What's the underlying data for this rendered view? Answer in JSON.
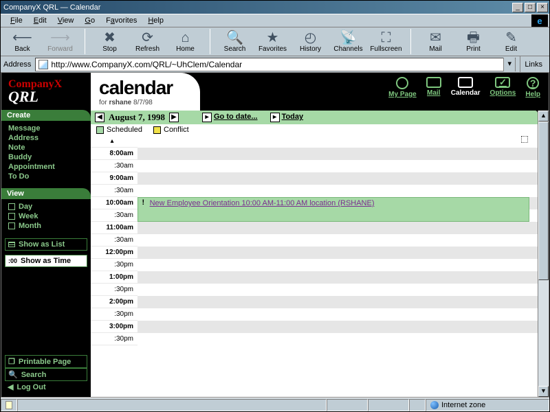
{
  "window": {
    "title": "CompanyX QRL — Calendar"
  },
  "menubar": {
    "file": "File",
    "edit": "Edit",
    "view": "View",
    "go": "Go",
    "favorites": "Favorites",
    "help": "Help"
  },
  "toolbar": {
    "back": "Back",
    "forward": "Forward",
    "stop": "Stop",
    "refresh": "Refresh",
    "home": "Home",
    "search": "Search",
    "favorites": "Favorites",
    "history": "History",
    "channels": "Channels",
    "fullscreen": "Fullscreen",
    "mail": "Mail",
    "print": "Print",
    "edit": "Edit"
  },
  "address": {
    "label": "Address",
    "url": "http://www.CompanyX.com/QRL/~UhClem/Calendar",
    "links": "Links"
  },
  "brand": {
    "company": "CompanyX",
    "app": "QRL"
  },
  "sidebar": {
    "create_head": "Create",
    "create": [
      "Message",
      "Address",
      "Note",
      "Buddy",
      "Appointment",
      "To Do"
    ],
    "view_head": "View",
    "view": [
      "Day",
      "Week",
      "Month"
    ],
    "show_list": "Show as List",
    "show_time": "Show as Time",
    "printable": "Printable Page",
    "search": "Search",
    "logout": "Log Out"
  },
  "header": {
    "title": "calendar",
    "for_prefix": "for ",
    "user": "rshane",
    "date_short": "8/7/98"
  },
  "topnav": {
    "mypage": "My Page",
    "mail": "Mail",
    "calendar": "Calendar",
    "options": "Options",
    "help": "Help"
  },
  "datebar": {
    "date": "August 7, 1998",
    "goto": "Go to date...",
    "today": "Today"
  },
  "legend": {
    "scheduled": "Scheduled",
    "conflict": "Conflict"
  },
  "times": [
    "8:00am",
    ":30am",
    "9:00am",
    ":30am",
    "10:00am",
    ":30am",
    "11:00am",
    ":30am",
    "12:00pm",
    ":30pm",
    "1:00pm",
    ":30pm",
    "2:00pm",
    ":30pm",
    "3:00pm",
    ":30pm"
  ],
  "event": {
    "text": "New Employee Orientation 10:00 AM-11:00 AM location (RSHANE)"
  },
  "status": {
    "zone": "Internet zone"
  },
  "colors": {
    "scheduled": "#a6d9a6",
    "conflict": "#f2e24a"
  }
}
